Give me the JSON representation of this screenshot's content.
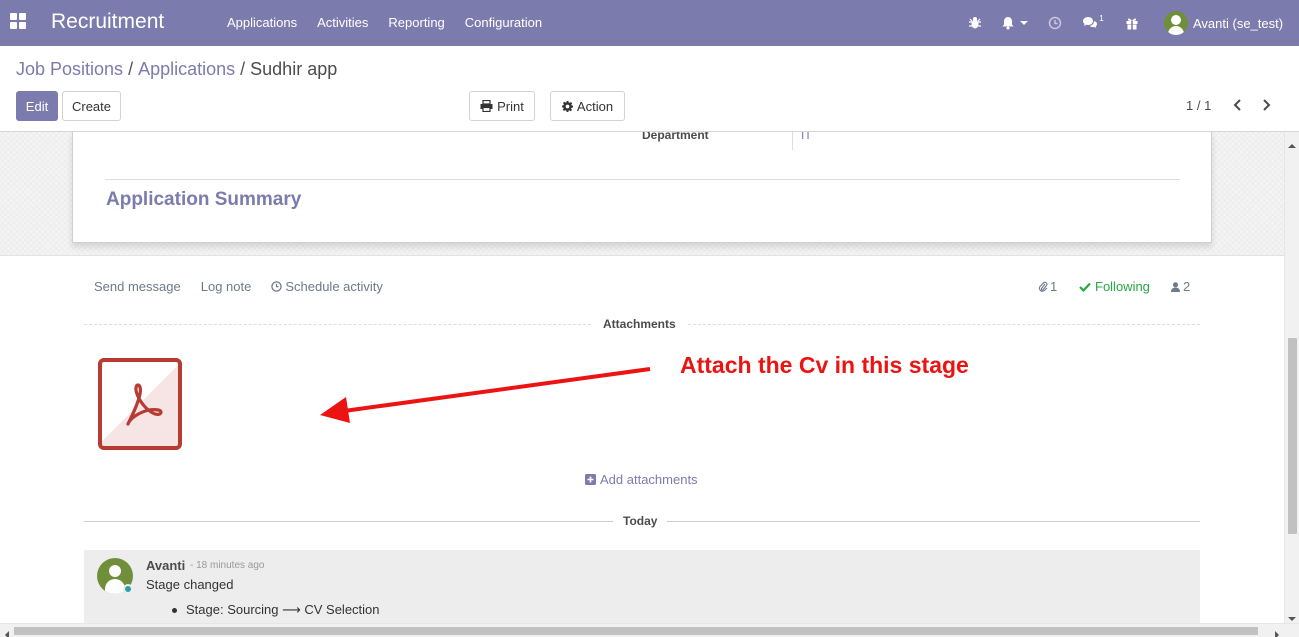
{
  "navbar": {
    "app_title": "Recruitment",
    "menu": [
      "Applications",
      "Activities",
      "Reporting",
      "Configuration"
    ],
    "messages_count": "1",
    "user": "Avanti (se_test)",
    "bg_color": "#7c7bad"
  },
  "breadcrumb": {
    "items": [
      "Job Positions",
      "Applications"
    ],
    "current": "Sudhir app",
    "separator": "/"
  },
  "toolbar": {
    "edit_label": "Edit",
    "create_label": "Create",
    "print_label": "Print",
    "action_label": "Action",
    "pager": "1 / 1"
  },
  "form": {
    "department_label": "Department",
    "department_value": "IT",
    "section_title": "Application Summary"
  },
  "chatter": {
    "send_message": "Send message",
    "log_note": "Log note",
    "schedule_activity": "Schedule activity",
    "attachment_count": "1",
    "following": "Following",
    "followers_count": "2",
    "attachments_title": "Attachments",
    "add_attachments": "Add attachments",
    "today_label": "Today",
    "accent_color": "#28a745"
  },
  "annotation": {
    "text": "Attach the Cv in this stage",
    "color": "#ec1313"
  },
  "message": {
    "author": "Avanti",
    "date": "- 18 minutes ago",
    "body": "Stage changed",
    "tracking": "Stage: Sourcing ⟶ CV Selection"
  }
}
